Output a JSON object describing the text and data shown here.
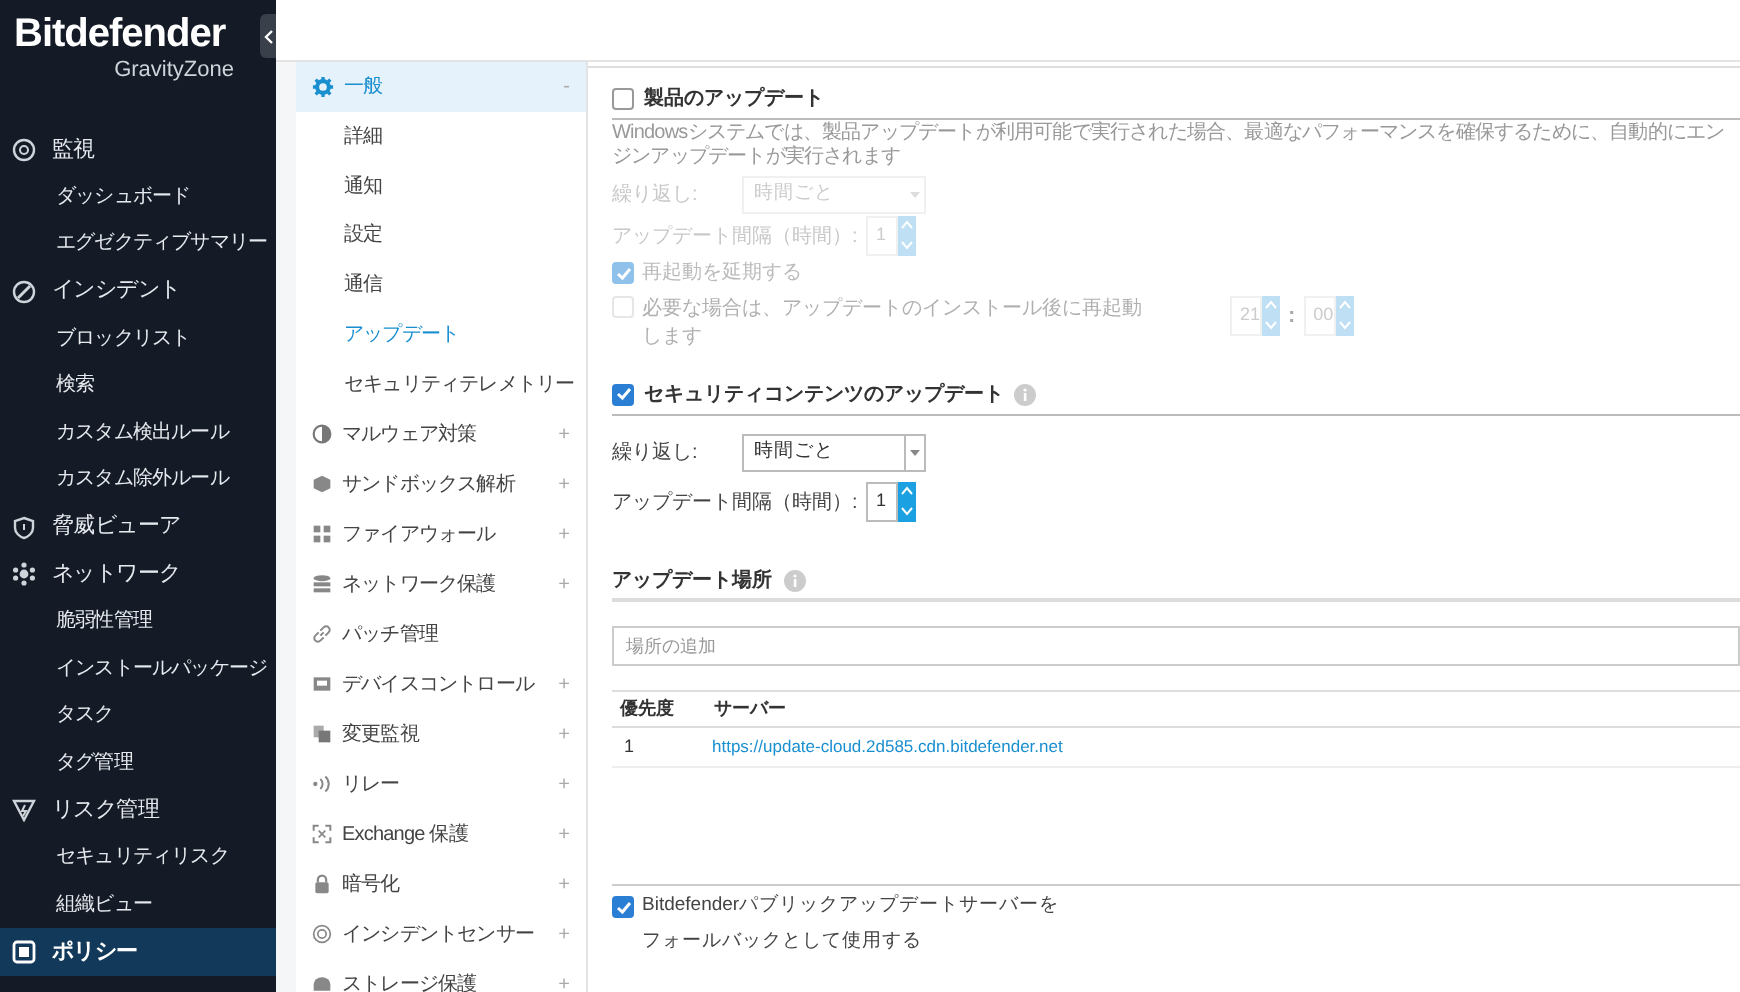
{
  "sidebar": {
    "logo": "Bitdefender",
    "logo_sub": "GravityZone",
    "items": [
      {
        "label": "監視",
        "selected": false,
        "children": [
          {
            "label": "ダッシュボード",
            "selected": false
          },
          {
            "label": "エグゼクティブサマリー",
            "selected": false
          }
        ]
      },
      {
        "label": "インシデント",
        "selected": false,
        "children": [
          {
            "label": "ブロックリスト",
            "selected": false
          },
          {
            "label": "検索",
            "selected": false
          },
          {
            "label": "カスタム検出ルール",
            "selected": false
          },
          {
            "label": "カスタム除外ルール",
            "selected": false
          }
        ]
      },
      {
        "label": "脅威ビューア",
        "selected": false
      },
      {
        "label": "ネットワーク",
        "selected": false,
        "children": [
          {
            "label": "脆弱性管理",
            "selected": false
          },
          {
            "label": "インストールパッケージ",
            "selected": false
          },
          {
            "label": "タスク",
            "selected": false
          },
          {
            "label": "タグ管理",
            "selected": false
          }
        ]
      },
      {
        "label": "リスク管理",
        "selected": false,
        "children": [
          {
            "label": "セキュリティリスク",
            "selected": false
          },
          {
            "label": "組織ビュー",
            "selected": false
          }
        ]
      },
      {
        "label": "ポリシー",
        "selected": true
      }
    ]
  },
  "policy_menu": {
    "items": [
      {
        "label": "一般",
        "toggle": "-",
        "expanded": true,
        "children": [
          {
            "label": "詳細",
            "selected": false
          },
          {
            "label": "通知",
            "selected": false
          },
          {
            "label": "設定",
            "selected": false
          },
          {
            "label": "通信",
            "selected": false
          },
          {
            "label": "アップデート",
            "selected": true
          },
          {
            "label": "セキュリティテレメトリー",
            "selected": false
          }
        ]
      },
      {
        "label": "マルウェア対策",
        "toggle": "+",
        "expanded": false
      },
      {
        "label": "サンドボックス解析",
        "toggle": "+",
        "expanded": false
      },
      {
        "label": "ファイアウォール",
        "toggle": "+",
        "expanded": false
      },
      {
        "label": "ネットワーク保護",
        "toggle": "+",
        "expanded": false
      },
      {
        "label": "パッチ管理",
        "expanded": false
      },
      {
        "label": "デバイスコントロール",
        "toggle": "+",
        "expanded": false
      },
      {
        "label": "変更監視",
        "toggle": "+",
        "expanded": false
      },
      {
        "label": "リレー",
        "toggle": "+",
        "expanded": false
      },
      {
        "label": "Exchange 保護",
        "toggle": "+",
        "expanded": false
      },
      {
        "label": "暗号化",
        "toggle": "+",
        "expanded": false
      },
      {
        "label": "インシデントセンサー",
        "toggle": "+",
        "expanded": false
      },
      {
        "label": "ストレージ保護",
        "toggle": "+",
        "expanded": false
      }
    ]
  },
  "product_update": {
    "title": "製品のアップデート",
    "checked": false,
    "disabled": true,
    "description": "Windowsシステムでは、製品アップデートが利用可能で実行された場合、最適なパフォーマンスを確保するために、自動的にエンジンアップデートが実行されます",
    "repeat": {
      "label": "繰り返し:",
      "value": "時間ごと"
    },
    "interval": {
      "label": "アップデート間隔（時間）:",
      "value": "1"
    },
    "postpone": {
      "label": "再起動を延期する",
      "checked": true
    },
    "restart": {
      "label": "必要な場合は、アップデートのインストール後に再起動します",
      "checked": false,
      "hour": "21",
      "separator": ":",
      "minute": "00"
    }
  },
  "security_update": {
    "title": "セキュリティコンテンツのアップデート",
    "checked": true,
    "disabled": false,
    "repeat": {
      "label": "繰り返し:",
      "value": "時間ごと"
    },
    "interval": {
      "label": "アップデート間隔（時間）:",
      "value": "1"
    }
  },
  "update_locations": {
    "title": "アップデート場所",
    "add_placeholder": "場所の追加",
    "columns": [
      "優先度",
      "サーバー"
    ],
    "rows": [
      {
        "priority": "1",
        "server": "https://update-cloud.2d585.cdn.bitdefender.net"
      }
    ]
  },
  "fallback": {
    "label": "Bitdefenderパブリックアップデートサーバーをフォールバックとして使用する",
    "checked": true
  }
}
